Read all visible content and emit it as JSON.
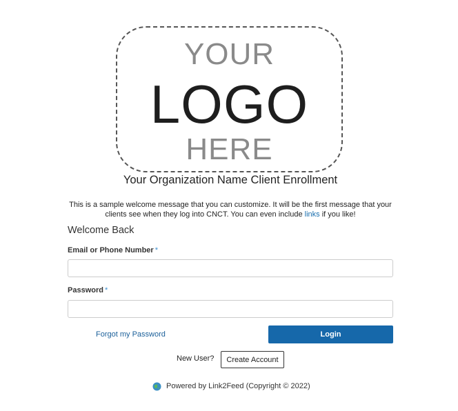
{
  "logo": {
    "line1": "YOUR",
    "line2": "LOGO",
    "line3": "HERE"
  },
  "header": {
    "title": "Your Organization Name Client Enrollment"
  },
  "welcome_message": {
    "text_before_link": "This is a sample welcome message that you can customize. It will be the first message that your clients see when they log into CNCT. You can even include ",
    "link_text": "links",
    "text_after_link": " if you like!"
  },
  "form": {
    "heading": "Welcome Back",
    "email_label": "Email or Phone Number",
    "email_required_mark": "*",
    "email_value": "",
    "password_label": "Password",
    "password_required_mark": "*",
    "password_value": "",
    "forgot_label": "Forgot my Password",
    "login_label": "Login"
  },
  "signup": {
    "prompt": "New User?",
    "create_label": "Create Account"
  },
  "footer": {
    "text": "Powered by Link2Feed (Copyright © 2022)",
    "icon": "globe-icon"
  },
  "colors": {
    "primary_button": "#1668aa",
    "link": "#1a5f99",
    "required_mark": "#3b8fd0"
  }
}
